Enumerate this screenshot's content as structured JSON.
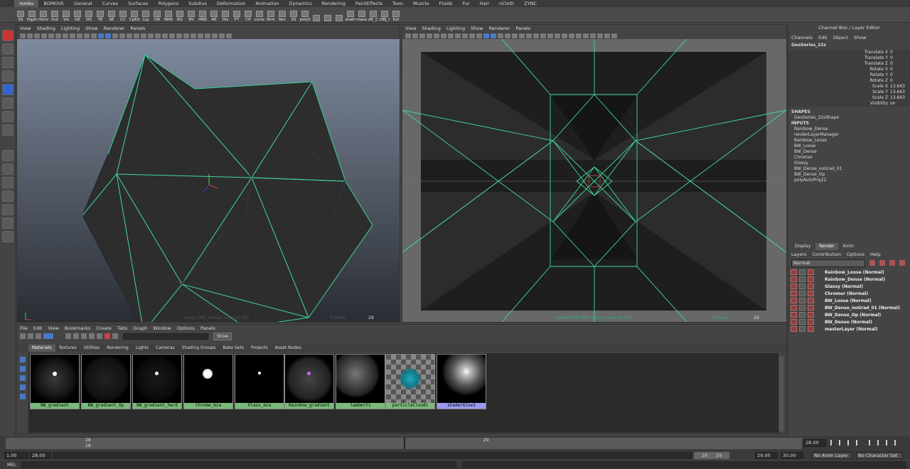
{
  "shelf": {
    "tabs": [
      "mmku",
      "BDMOVE",
      "General",
      "Curves",
      "Surfaces",
      "Polygons",
      "Subdivs",
      "Deformation",
      "Animation",
      "Dynamics",
      "Rendering",
      "PaintEffects",
      "Toon",
      "Muscle",
      "Fluids",
      "Fur",
      "Hair",
      "nCloth",
      "ZYNC"
    ],
    "active_tab": "mmku",
    "buttons": [
      "SS",
      "Hgph",
      "Hshd",
      "Out",
      "Vis",
      "GE",
      "DS",
      "TE",
      "SE",
      "CC",
      "CpEd",
      "Lig",
      "DR",
      "BRN",
      "RG",
      "RV",
      "HRB",
      "AE",
      "His",
      "FT",
      "CP",
      "curre",
      "Nrm",
      "Nor",
      "SS",
      "polyS",
      "",
      "",
      "",
      "shakr",
      "mass",
      "AE_C",
      "OBJ_I",
      "Ext"
    ]
  },
  "viewport_left": {
    "menu": [
      "View",
      "Shading",
      "Lighting",
      "Show",
      "Renderer",
      "Panels"
    ],
    "camera_label": "persp (BW_Dense_noGrad_01)",
    "frame_label": "Frames:",
    "frame_value": "28"
  },
  "viewport_right": {
    "menu": [
      "View",
      "Shading",
      "Lighting",
      "Show",
      "Renderer",
      "Panels"
    ],
    "camera_label": "renderCAM (BW_Dense_noGrad_01)",
    "frame_label": "Frames:",
    "frame_value": "28"
  },
  "channel_box": {
    "title": "Channel Box / Layer Editor",
    "menu": [
      "Channels",
      "Edit",
      "Object",
      "Show"
    ],
    "object": "GeoSeries_22s",
    "attributes": [
      {
        "name": "Translate X",
        "value": "0"
      },
      {
        "name": "Translate Y",
        "value": "0"
      },
      {
        "name": "Translate Z",
        "value": "0"
      },
      {
        "name": "Rotate X",
        "value": "0"
      },
      {
        "name": "Rotate Y",
        "value": "0"
      },
      {
        "name": "Rotate Z",
        "value": "0"
      },
      {
        "name": "Scale X",
        "value": "13.663"
      },
      {
        "name": "Scale Y",
        "value": "13.663"
      },
      {
        "name": "Scale Z",
        "value": "13.663"
      },
      {
        "name": "Visibility",
        "value": "on"
      }
    ],
    "shapes_header": "SHAPES",
    "shape": "GeoSeries_22sShape",
    "inputs_header": "INPUTS",
    "inputs": [
      "Rainbow_Dense",
      "renderLayerManager",
      "Rainbow_Loose",
      "BW_Loose",
      "BW_Dense",
      "Chromer",
      "Glassy",
      "BW_Dense_noGrad_01",
      "BW_Dense_Op",
      "polyAutoProj22"
    ]
  },
  "layer_editor": {
    "tabs": [
      "Display",
      "Render",
      "Anim"
    ],
    "active_tab": "Render",
    "menu": [
      "Layers",
      "Contribution",
      "Options",
      "Help"
    ],
    "blend_mode": "Normal",
    "layers": [
      "Rainbow_Loose (Normal)",
      "Rainbow_Dense (Normal)",
      "Glassy (Normal)",
      "Chromer (Normal)",
      "BW_Loose (Normal)",
      "BW_Dense_noGrad_01 (Normal)",
      "BW_Dense_Op (Normal)",
      "BW_Dense (Normal)",
      "masterLayer (Normal)"
    ]
  },
  "hypershade": {
    "menu": [
      "File",
      "Edit",
      "View",
      "Bookmarks",
      "Create",
      "Tabs",
      "Graph",
      "Window",
      "Options",
      "Panels"
    ],
    "show_button": "Show",
    "tabs": [
      "Materials",
      "Textures",
      "Utilities",
      "Rendering",
      "Lights",
      "Cameras",
      "Shading Groups",
      "Bake Sets",
      "Projects",
      "Asset Nodes"
    ],
    "active_tab": "Materials",
    "materials": [
      "BW_gradient",
      "BW_gradient_Op",
      "BW_gradient_hard",
      "Chrome_mia",
      "Glass_mia",
      "Rainbow_gradient",
      "lambert1",
      "particleCloud1",
      "shaderGlow1"
    ]
  },
  "timeline": {
    "current_frame": "28",
    "frame_marker_top": "28",
    "frame_marker_bottom": "28",
    "frame_29": "29",
    "end_field": "28.00"
  },
  "range": {
    "start": "1.00",
    "start_inner": "28.00",
    "end_inner_a": "28",
    "end_inner_b": "29",
    "end": "29.00",
    "end_outer": "30.00",
    "anim_layer": "No Anim Layer",
    "char_set": "No Character Set"
  },
  "command_line": {
    "label": "MEL"
  },
  "colors": {
    "wire": "#3fd9a0",
    "selected_label": "#9a9aee",
    "material_label": "#7aba7a"
  }
}
